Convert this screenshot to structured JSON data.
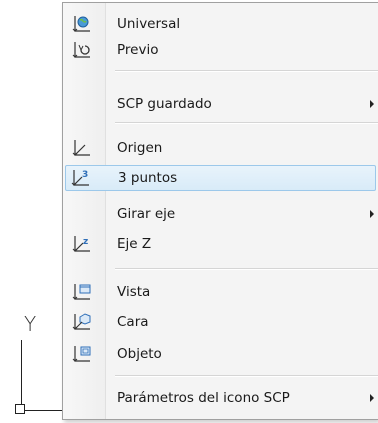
{
  "axis_label": "Y",
  "menu": {
    "items": [
      {
        "label": "Universal",
        "icon": "world-ucs-icon"
      },
      {
        "label": "Previo",
        "icon": "previous-ucs-icon"
      },
      {
        "label": "SCP guardado",
        "submenu": true
      },
      {
        "label": "Origen",
        "icon": "origin-icon"
      },
      {
        "label": "3 puntos",
        "icon": "three-point-icon",
        "highlighted": true
      },
      {
        "label": "Girar eje",
        "submenu": true
      },
      {
        "label": "Eje Z",
        "icon": "z-axis-icon"
      },
      {
        "label": "Vista",
        "icon": "view-icon"
      },
      {
        "label": "Cara",
        "icon": "face-icon"
      },
      {
        "label": "Objeto",
        "icon": "object-icon"
      },
      {
        "label": "Parámetros del icono SCP",
        "submenu": true
      }
    ]
  },
  "colors": {
    "highlight_border": "#9cc8ea",
    "highlight_bg": "#dcecf9",
    "icon_blue": "#2f6fb8"
  }
}
